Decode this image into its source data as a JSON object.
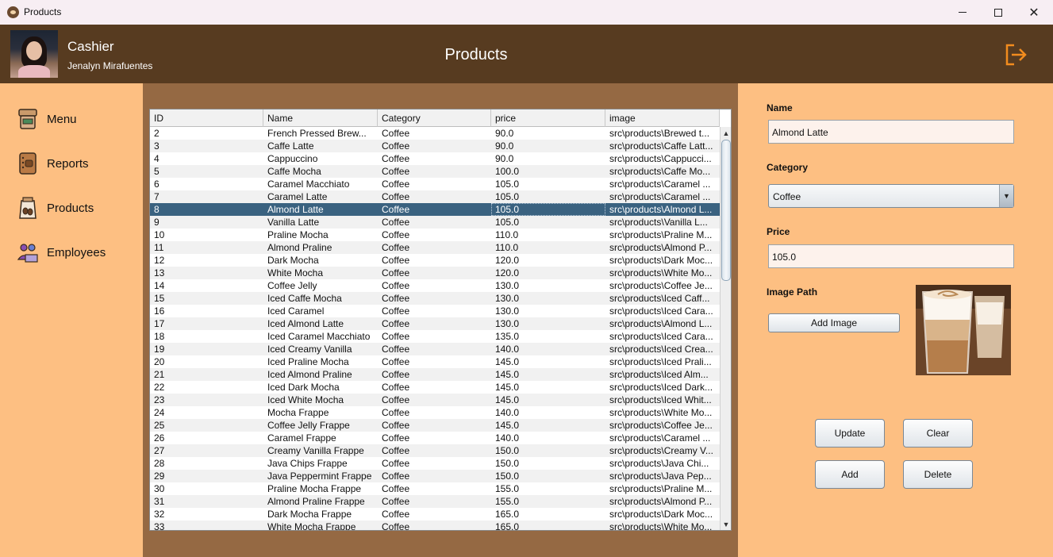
{
  "window": {
    "title": "Products"
  },
  "header": {
    "role": "Cashier",
    "user_name": "Jenalyn Mirafuentes",
    "page_title": "Products"
  },
  "sidebar": {
    "items": [
      {
        "label": "Menu",
        "icon": "menu-icon"
      },
      {
        "label": "Reports",
        "icon": "reports-icon"
      },
      {
        "label": "Products",
        "icon": "products-icon"
      },
      {
        "label": "Employees",
        "icon": "employees-icon"
      }
    ]
  },
  "table": {
    "columns": [
      "ID",
      "Name",
      "Category",
      "price",
      "image"
    ],
    "selected_id": "8",
    "rows": [
      [
        "2",
        "French Pressed Brew...",
        "Coffee",
        "90.0",
        "src\\products\\Brewed t..."
      ],
      [
        "3",
        "Caffe Latte",
        "Coffee",
        "90.0",
        "src\\products\\Caffe Latt..."
      ],
      [
        "4",
        "Cappuccino",
        "Coffee",
        "90.0",
        "src\\products\\Cappucci..."
      ],
      [
        "5",
        "Caffe Mocha",
        "Coffee",
        "100.0",
        "src\\products\\Caffe Mo..."
      ],
      [
        "6",
        "Caramel Macchiato",
        "Coffee",
        "105.0",
        "src\\products\\Caramel ..."
      ],
      [
        "7",
        "Caramel Latte",
        "Coffee",
        "105.0",
        "src\\products\\Caramel ..."
      ],
      [
        "8",
        "Almond Latte",
        "Coffee",
        "105.0",
        "src\\products\\Almond L..."
      ],
      [
        "9",
        "Vanilla Latte",
        "Coffee",
        "105.0",
        "src\\products\\Vanilla L..."
      ],
      [
        "10",
        "Praline Mocha",
        "Coffee",
        "110.0",
        "src\\products\\Praline M..."
      ],
      [
        "11",
        "Almond Praline",
        "Coffee",
        "110.0",
        "src\\products\\Almond P..."
      ],
      [
        "12",
        "Dark Mocha",
        "Coffee",
        "120.0",
        "src\\products\\Dark Moc..."
      ],
      [
        "13",
        "White Mocha",
        "Coffee",
        "120.0",
        "src\\products\\White Mo..."
      ],
      [
        "14",
        "Coffee Jelly",
        "Coffee",
        "130.0",
        "src\\products\\Coffee Je..."
      ],
      [
        "15",
        "Iced Caffe Mocha",
        "Coffee",
        "130.0",
        "src\\products\\Iced Caff..."
      ],
      [
        "16",
        "Iced Caramel",
        "Coffee",
        "130.0",
        "src\\products\\Iced Cara..."
      ],
      [
        "17",
        "Iced Almond Latte",
        "Coffee",
        "130.0",
        "src\\products\\Almond L..."
      ],
      [
        "18",
        "Iced Caramel Macchiato",
        "Coffee",
        "135.0",
        "src\\products\\Iced Cara..."
      ],
      [
        "19",
        "Iced Creamy Vanilla",
        "Coffee",
        "140.0",
        "src\\products\\Iced Crea..."
      ],
      [
        "20",
        "Iced Praline Mocha",
        "Coffee",
        "145.0",
        "src\\products\\Iced Prali..."
      ],
      [
        "21",
        "Iced Almond Praline",
        "Coffee",
        "145.0",
        "src\\products\\Iced Alm..."
      ],
      [
        "22",
        "Iced Dark Mocha",
        "Coffee",
        "145.0",
        "src\\products\\Iced Dark..."
      ],
      [
        "23",
        "Iced White Mocha",
        "Coffee",
        "145.0",
        "src\\products\\Iced Whit..."
      ],
      [
        "24",
        "Mocha Frappe",
        "Coffee",
        "140.0",
        "src\\products\\White Mo..."
      ],
      [
        "25",
        "Coffee Jelly Frappe",
        "Coffee",
        "145.0",
        "src\\products\\Coffee Je..."
      ],
      [
        "26",
        "Caramel Frappe",
        "Coffee",
        "140.0",
        "src\\products\\Caramel ..."
      ],
      [
        "27",
        "Creamy Vanilla Frappe",
        "Coffee",
        "150.0",
        "src\\products\\Creamy V..."
      ],
      [
        "28",
        "Java Chips Frappe",
        "Coffee",
        "150.0",
        "src\\products\\Java Chi..."
      ],
      [
        "29",
        "Java Peppermint Frappe",
        "Coffee",
        "150.0",
        "src\\products\\Java Pep..."
      ],
      [
        "30",
        "Praline Mocha Frappe",
        "Coffee",
        "155.0",
        "src\\products\\Praline M..."
      ],
      [
        "31",
        "Almond Praline Frappe",
        "Coffee",
        "155.0",
        "src\\products\\Almond P..."
      ],
      [
        "32",
        "Dark Mocha Frappe",
        "Coffee",
        "165.0",
        "src\\products\\Dark Moc..."
      ],
      [
        "33",
        "White Mocha Frappe",
        "Coffee",
        "165.0",
        "src\\products\\White Mo..."
      ]
    ]
  },
  "form": {
    "name_label": "Name",
    "name_value": "Almond Latte",
    "category_label": "Category",
    "category_value": "Coffee",
    "price_label": "Price",
    "price_value": "105.0",
    "image_label": "Image Path",
    "add_image_label": "Add Image",
    "update_label": "Update",
    "clear_label": "Clear",
    "add_label": "Add",
    "delete_label": "Delete"
  },
  "colors": {
    "header_bg": "#573b20",
    "panel_bg": "#fdbf82",
    "center_bg": "#956943",
    "selected_row": "#3a6280",
    "logout_icon": "#f28c1e"
  }
}
